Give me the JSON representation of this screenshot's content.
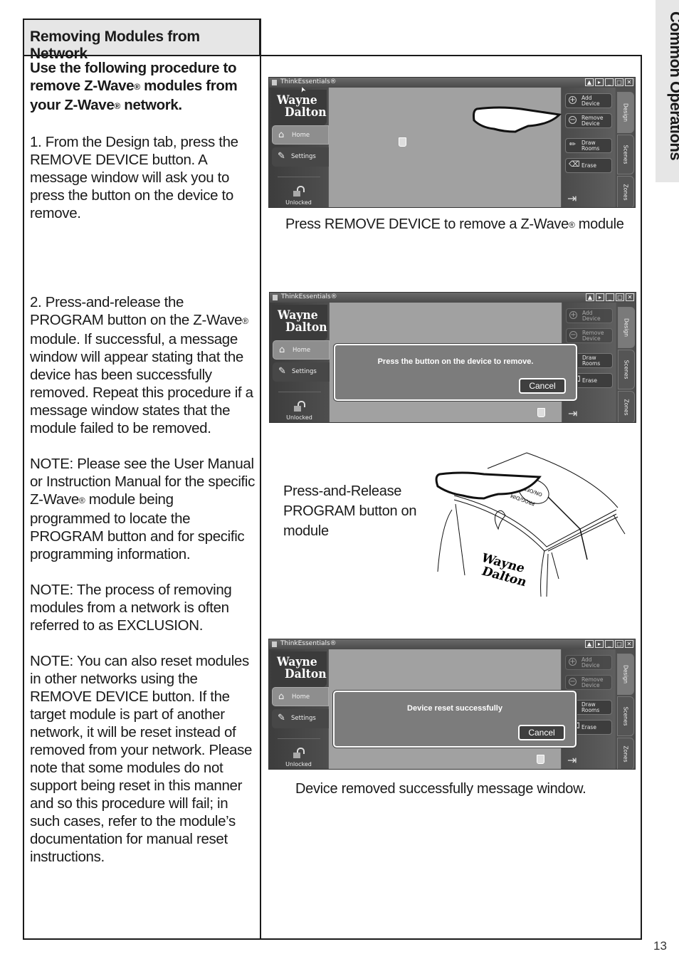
{
  "section_header": "Removing Modules from Network",
  "side_tab": "Common Operations",
  "page_number": "13",
  "left_column": {
    "intro": [
      "Use the following procedure to remove Z-Wave",
      "®",
      " modules from your Z-Wave",
      "®",
      " network."
    ],
    "step1": "1.  From the Design tab, press the REMOVE DEVICE button.  A message window will ask you to press the button on the device to remove.",
    "step2": [
      "2.  Press-and-release the PROGRAM button on the Z-Wave",
      "®",
      " module.  If successful, a message window will appear stating that the device has been successfully removed.  Repeat this procedure if a message window states that the module failed to be removed."
    ],
    "note1": [
      "NOTE:  Please see the User Manual or Instruction Manual for the specific Z-Wave",
      "®",
      " module being programmed to locate the PROGRAM button and for specific programming information."
    ],
    "note2": "NOTE:  The process of removing modules from a network is often referred to as EXCLUSION.",
    "note3": "NOTE:  You can also reset modules in other networks using the REMOVE DEVICE button.  If the target module is part of another network, it will be reset instead of removed from your network.  Please note that some modules do not support being reset in this manner and so this procedure will fail; in such cases, refer to the module’s documentation for manual reset instructions."
  },
  "app": {
    "title": "ThinkEssentials®",
    "logo_line1": "Wayne",
    "logo_line2": "Dalton",
    "nav_home": "Home",
    "nav_settings": "Settings",
    "lock_status": "Unlocked",
    "btn_add": [
      "Add",
      "Device"
    ],
    "btn_remove": [
      "Remove",
      "Device"
    ],
    "btn_draw": [
      "Draw",
      "Rooms"
    ],
    "btn_erase": "Erase",
    "tabs": [
      "Design",
      "Scenes",
      "Zones"
    ],
    "window_buttons": [
      "▲",
      "▸",
      "_",
      "□",
      "✕"
    ]
  },
  "screens": [
    {
      "caption": [
        "Press REMOVE DEVICE to remove a Z-Wave",
        "®",
        " module"
      ]
    },
    {
      "dialog_message": "Press the button on the device to remove.",
      "dialog_button": "Cancel"
    },
    {
      "caption": "Press-and-Release PROGRAM button on module",
      "module_labels": [
        "ON/OFF",
        "PROG/DIM"
      ],
      "module_logo": [
        "Wayne",
        "Dalton"
      ]
    },
    {
      "dialog_message": "Device reset successfully",
      "dialog_button": "Cancel",
      "caption": "Device removed successfully message window."
    }
  ]
}
